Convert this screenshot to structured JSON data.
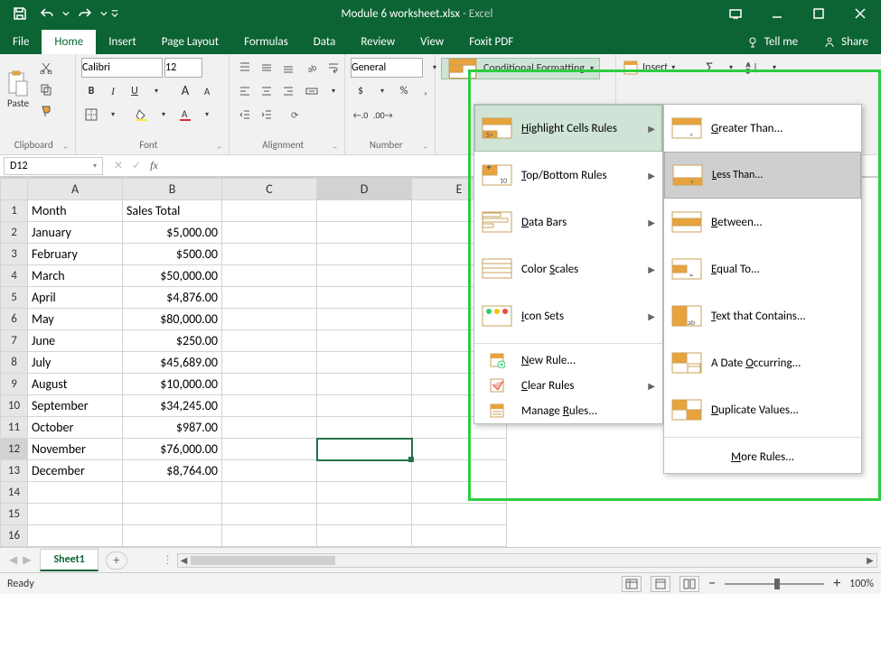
{
  "titlebar": {
    "filename": "Module 6 worksheet.xlsx",
    "sep": "  -  ",
    "app": "Excel"
  },
  "tabs": {
    "file": "File",
    "home": "Home",
    "insert": "Insert",
    "page_layout": "Page Layout",
    "formulas": "Formulas",
    "data": "Data",
    "review": "Review",
    "view": "View",
    "foxit": "Foxit PDF",
    "tell": "Tell me",
    "share": "Share"
  },
  "ribbon": {
    "clipboard": {
      "paste": "Paste",
      "label": "Clipboard"
    },
    "font": {
      "name": "Calibri",
      "size": "12",
      "label": "Font",
      "bold": "B",
      "italic": "I",
      "underline": "U",
      "inc": "A",
      "dec": "A"
    },
    "alignment": {
      "label": "Alignment"
    },
    "number": {
      "general": "General",
      "label": "Number",
      "cur": "$",
      "pct": "%",
      "comma": ",",
      "incdec": ".0",
      "decdec": ".00"
    },
    "styles": {
      "cond": "Conditional Formatting"
    },
    "cells": {
      "insert": "Insert"
    },
    "edit": {
      "sum": "Σ",
      "sort": "A Z"
    }
  },
  "fbar": {
    "namebox": "D12"
  },
  "cols": [
    "A",
    "B",
    "C",
    "D",
    "E"
  ],
  "rows": [
    1,
    2,
    3,
    4,
    5,
    6,
    7,
    8,
    9,
    10,
    11,
    12,
    13,
    14,
    15,
    16
  ],
  "grid": {
    "A1": "Month",
    "B1": "Sales Total",
    "A2": "January",
    "B2": "$5,000.00",
    "A3": "February",
    "B3": "$500.00",
    "A4": "March",
    "B4": "$50,000.00",
    "A5": "April",
    "B5": "$4,876.00",
    "A6": "May",
    "B6": "$80,000.00",
    "A7": "June",
    "B7": "$250.00",
    "A8": "July",
    "B8": "$45,689.00",
    "A9": "August",
    "B9": "$10,000.00",
    "A10": "September",
    "B10": "$34,245.00",
    "A11": "October",
    "B11": "$987.00",
    "A12": "November",
    "B12": "$76,000.00",
    "A13": "December",
    "B13": "$8,764.00"
  },
  "sheettabs": {
    "sheet1": "Sheet1"
  },
  "status": {
    "ready": "Ready",
    "zoom": "100%"
  },
  "menu1": {
    "highlight": "Highlight Cells Rules",
    "topbottom": "Top/Bottom Rules",
    "databars": "Data Bars",
    "colorscales": "Color Scales",
    "iconsets": "Icon Sets",
    "newrule": "New Rule...",
    "clear": "Clear Rules",
    "manage": "Manage Rules..."
  },
  "menu2": {
    "greater": "Greater Than...",
    "less": "Less Than...",
    "between": "Between...",
    "equal": "Equal To...",
    "text": "Text that Contains...",
    "date": "A Date Occurring...",
    "dup": "Duplicate Values...",
    "more": "More Rules..."
  }
}
